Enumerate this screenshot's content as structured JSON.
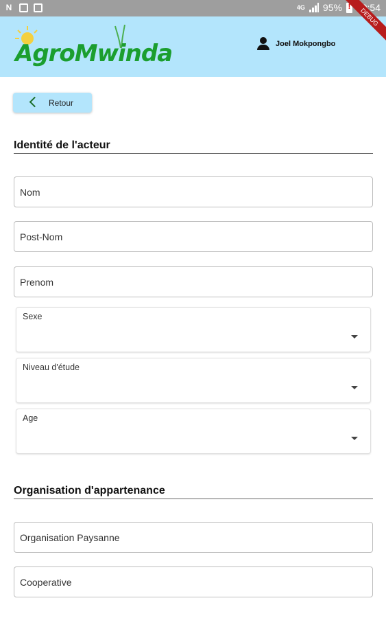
{
  "status_bar": {
    "network": "4G",
    "battery": "95%",
    "time": "09:54"
  },
  "debug_banner": "DEBUG",
  "header": {
    "app_name": "AgroMwinda",
    "user_name": "Joel Mokpongbo"
  },
  "back_button": {
    "label": "Retour"
  },
  "sections": {
    "identity": "Identité de l'acteur",
    "organisation": "Organisation d'appartenance"
  },
  "fields": {
    "nom": {
      "placeholder": "Nom",
      "value": ""
    },
    "post_nom": {
      "placeholder": "Post-Nom",
      "value": ""
    },
    "prenom": {
      "placeholder": "Prenom",
      "value": ""
    },
    "organisation_paysanne": {
      "placeholder": "Organisation Paysanne",
      "value": ""
    },
    "cooperative": {
      "placeholder": "Cooperative",
      "value": ""
    }
  },
  "dropdowns": {
    "sexe": {
      "label": "Sexe",
      "selected": ""
    },
    "niveau_etude": {
      "label": "Niveau d'étude",
      "selected": ""
    },
    "age": {
      "label": "Age",
      "selected": ""
    }
  },
  "colors": {
    "header_bg": "#b3e5fc",
    "brand_green": "#1b9e2f",
    "status_bar": "#9e9e9e",
    "debug_ribbon": "#b71c1c"
  },
  "icons": {
    "back": "chevron-left-icon",
    "user": "person-icon",
    "dropdown": "caret-down-icon"
  }
}
